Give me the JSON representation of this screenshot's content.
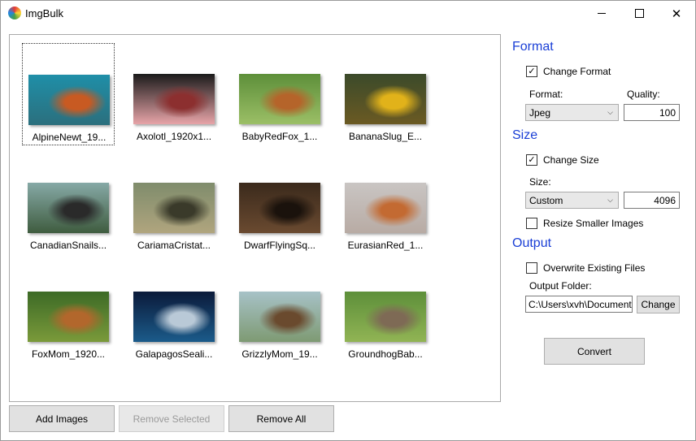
{
  "window": {
    "title": "ImgBulk"
  },
  "gallery": {
    "items": [
      {
        "label": "AlpineNewt_19...",
        "colors": [
          "#1f8fa8",
          "#2b6f7d",
          "#c85a22"
        ]
      },
      {
        "label": "Axolotl_1920x1...",
        "colors": [
          "#1b1b1b",
          "#e7a4a8",
          "#8c2f2f"
        ]
      },
      {
        "label": "BabyRedFox_1...",
        "colors": [
          "#5d8f3a",
          "#9bbf66",
          "#b5642a"
        ]
      },
      {
        "label": "BananaSlug_E...",
        "colors": [
          "#3b4a2a",
          "#6b5a23",
          "#e1b21a"
        ]
      },
      {
        "label": "CanadianSnails...",
        "colors": [
          "#86a9a6",
          "#3f5c3f",
          "#2a2a2a"
        ]
      },
      {
        "label": "CariamaCristat...",
        "colors": [
          "#7f8c6c",
          "#b0a57e",
          "#3a3a2a"
        ]
      },
      {
        "label": "DwarfFlyingSq...",
        "colors": [
          "#3b2a1c",
          "#6a4a30",
          "#1a120c"
        ]
      },
      {
        "label": "EurasianRed_1...",
        "colors": [
          "#c9c5c3",
          "#b8aba4",
          "#c36a32"
        ]
      },
      {
        "label": "FoxMom_1920...",
        "colors": [
          "#3c6a26",
          "#7a9a3a",
          "#b2672c"
        ]
      },
      {
        "label": "GalapagosSeali...",
        "colors": [
          "#0b1a3a",
          "#1b5b8a",
          "#b9c9d7"
        ]
      },
      {
        "label": "GrizzlyMom_19...",
        "colors": [
          "#a7c2c7",
          "#7e9a73",
          "#6a4a2e"
        ]
      },
      {
        "label": "GroundhogBab...",
        "colors": [
          "#5d8f3a",
          "#91b454",
          "#7e6a55"
        ]
      }
    ]
  },
  "buttons": {
    "add_images": "Add Images",
    "remove_selected": "Remove Selected",
    "remove_all": "Remove All",
    "convert": "Convert",
    "change": "Change"
  },
  "format": {
    "title": "Format",
    "change_format_label": "Change Format",
    "change_format_checked": true,
    "format_label": "Format:",
    "quality_label": "Quality:",
    "format_value": "Jpeg",
    "quality_value": "100"
  },
  "size": {
    "title": "Size",
    "change_size_label": "Change Size",
    "change_size_checked": true,
    "size_label": "Size:",
    "size_value": "Custom",
    "size_number": "4096",
    "resize_smaller_label": "Resize Smaller Images",
    "resize_smaller_checked": false
  },
  "output": {
    "title": "Output",
    "overwrite_label": "Overwrite Existing Files",
    "overwrite_checked": false,
    "folder_label": "Output Folder:",
    "folder_value": "C:\\Users\\xvh\\Documents"
  },
  "icons": {
    "check": "✓",
    "chevron": "⌵",
    "close": "✕"
  }
}
